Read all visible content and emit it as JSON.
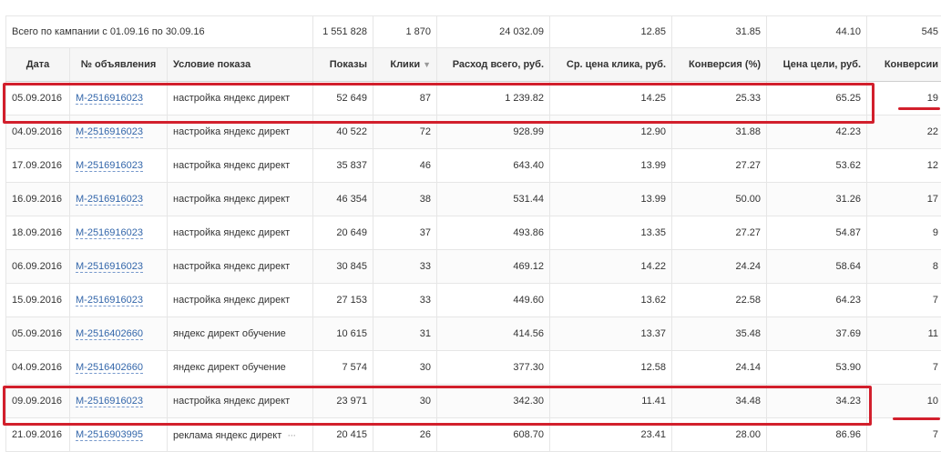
{
  "totals": {
    "label": "Всего по кампании с 01.09.16 по 30.09.16",
    "impressions": "1 551 828",
    "clicks": "1 870",
    "cost": "24 032.09",
    "cpc": "12.85",
    "conversion": "31.85",
    "goal_cost": "44.10",
    "conversions": "545"
  },
  "headers": {
    "date": "Дата",
    "ad": "№ объявления",
    "condition": "Условие показа",
    "impressions": "Показы",
    "clicks": "Клики",
    "cost": "Расход всего, руб.",
    "cpc": "Ср. цена клика, руб.",
    "conversion": "Конверсия (%)",
    "goal_cost": "Цена цели, руб.",
    "conversions": "Конверсии"
  },
  "sort_icon": "sort-desc-icon",
  "highlight_color": "#d21f2c",
  "rows": [
    {
      "date": "05.09.2016",
      "ad": "M-2516916023",
      "condition": "настройка яндекс директ",
      "impressions": "52 649",
      "clicks": "87",
      "cost": "1 239.82",
      "cpc": "14.25",
      "conversion": "25.33",
      "goal_cost": "65.25",
      "conversions": "19"
    },
    {
      "date": "04.09.2016",
      "ad": "M-2516916023",
      "condition": "настройка яндекс директ",
      "impressions": "40 522",
      "clicks": "72",
      "cost": "928.99",
      "cpc": "12.90",
      "conversion": "31.88",
      "goal_cost": "42.23",
      "conversions": "22"
    },
    {
      "date": "17.09.2016",
      "ad": "M-2516916023",
      "condition": "настройка яндекс директ",
      "impressions": "35 837",
      "clicks": "46",
      "cost": "643.40",
      "cpc": "13.99",
      "conversion": "27.27",
      "goal_cost": "53.62",
      "conversions": "12"
    },
    {
      "date": "16.09.2016",
      "ad": "M-2516916023",
      "condition": "настройка яндекс директ",
      "impressions": "46 354",
      "clicks": "38",
      "cost": "531.44",
      "cpc": "13.99",
      "conversion": "50.00",
      "goal_cost": "31.26",
      "conversions": "17"
    },
    {
      "date": "18.09.2016",
      "ad": "M-2516916023",
      "condition": "настройка яндекс директ",
      "impressions": "20 649",
      "clicks": "37",
      "cost": "493.86",
      "cpc": "13.35",
      "conversion": "27.27",
      "goal_cost": "54.87",
      "conversions": "9"
    },
    {
      "date": "06.09.2016",
      "ad": "M-2516916023",
      "condition": "настройка яндекс директ",
      "impressions": "30 845",
      "clicks": "33",
      "cost": "469.12",
      "cpc": "14.22",
      "conversion": "24.24",
      "goal_cost": "58.64",
      "conversions": "8"
    },
    {
      "date": "15.09.2016",
      "ad": "M-2516916023",
      "condition": "настройка яндекс директ",
      "impressions": "27 153",
      "clicks": "33",
      "cost": "449.60",
      "cpc": "13.62",
      "conversion": "22.58",
      "goal_cost": "64.23",
      "conversions": "7"
    },
    {
      "date": "05.09.2016",
      "ad": "M-2516402660",
      "condition": "яндекс директ обучение",
      "impressions": "10 615",
      "clicks": "31",
      "cost": "414.56",
      "cpc": "13.37",
      "conversion": "35.48",
      "goal_cost": "37.69",
      "conversions": "11"
    },
    {
      "date": "04.09.2016",
      "ad": "M-2516402660",
      "condition": "яндекс директ обучение",
      "impressions": "7 574",
      "clicks": "30",
      "cost": "377.30",
      "cpc": "12.58",
      "conversion": "24.14",
      "goal_cost": "53.90",
      "conversions": "7"
    },
    {
      "date": "09.09.2016",
      "ad": "M-2516916023",
      "condition": "настройка яндекс директ",
      "impressions": "23 971",
      "clicks": "30",
      "cost": "342.30",
      "cpc": "11.41",
      "conversion": "34.48",
      "goal_cost": "34.23",
      "conversions": "10"
    },
    {
      "date": "21.09.2016",
      "ad": "M-2516903995",
      "condition": "реклама яндекс директ",
      "impressions": "20 415",
      "clicks": "26",
      "cost": "608.70",
      "cpc": "23.41",
      "conversion": "28.00",
      "goal_cost": "86.96",
      "conversions": "7",
      "has_more": true
    }
  ]
}
